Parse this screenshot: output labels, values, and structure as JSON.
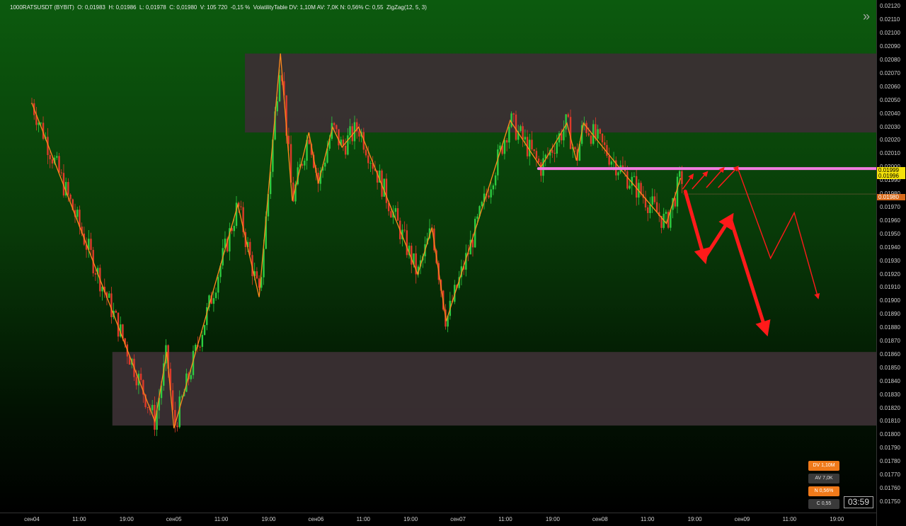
{
  "header": {
    "symbol": "1000RATSUSDT (BYBIT)",
    "open": "O: 0,01983",
    "high": "H: 0,01986",
    "low": "L: 0,01978",
    "close": "C: 0,01980",
    "volume": "V: 105 720",
    "change": "-0,15 %",
    "indicator1": "VolatilityTable  DV: 1,10M  AV: 7,0K  N: 0,56%  C: 0,55",
    "indicator2": "ZigZag(12, 5, 3)"
  },
  "price_tags": {
    "level": "0.01999",
    "level2": "0.01996",
    "last": "0.01980"
  },
  "badges": {
    "dv": "DV 1,10M",
    "av": "AV 7,0K",
    "n": "N 0,56%",
    "c": "C 0,55"
  },
  "clock": "03:59",
  "colors": {
    "zigzag": "#ff8a1c",
    "level_line": "#f07ce0",
    "arrows": "#ff1a1a",
    "zone": "#3a2f33",
    "bull": "#2ecc40",
    "bear": "#e03a2a"
  },
  "chart_data": {
    "type": "candlestick",
    "y_ticks": [
      "0.02120",
      "0.02110",
      "0.02100",
      "0.02090",
      "0.02080",
      "0.02070",
      "0.02060",
      "0.02050",
      "0.02040",
      "0.02030",
      "0.02020",
      "0.02010",
      "0.02000",
      "0.01990",
      "0.01980",
      "0.01970",
      "0.01960",
      "0.01950",
      "0.01940",
      "0.01930",
      "0.01920",
      "0.01910",
      "0.01900",
      "0.01890",
      "0.01880",
      "0.01870",
      "0.01860",
      "0.01850",
      "0.01840",
      "0.01830",
      "0.01820",
      "0.01810",
      "0.01800",
      "0.01790",
      "0.01780",
      "0.01770",
      "0.01760",
      "0.01750"
    ],
    "x_ticks": [
      "сен04",
      "11:00",
      "19:00",
      "сен05",
      "11:00",
      "19:00",
      "сен06",
      "11:00",
      "19:00",
      "сен07",
      "11:00",
      "19:00",
      "сен08",
      "11:00",
      "19:00",
      "сен09",
      "11:00",
      "19:00"
    ],
    "ylim": [
      0.01742,
      0.02125
    ],
    "zones": [
      {
        "name": "supply",
        "top": 0.02085,
        "bottom": 0.02026,
        "from": 4.5,
        "to": 18.1
      },
      {
        "name": "demand",
        "top": 0.01862,
        "bottom": 0.01807,
        "from": 1.7,
        "to": 18.6
      }
    ],
    "level": {
      "price": 0.01999,
      "from": 10.7,
      "to": 18.5
    },
    "zigzag": [
      [
        0.0,
        0.02048
      ],
      [
        2.6,
        0.0181
      ],
      [
        2.85,
        0.01862
      ],
      [
        3.0,
        0.01805
      ],
      [
        4.35,
        0.01972
      ],
      [
        4.8,
        0.01903
      ],
      [
        5.25,
        0.02085
      ],
      [
        5.5,
        0.01975
      ],
      [
        5.85,
        0.02026
      ],
      [
        6.05,
        0.01988
      ],
      [
        6.35,
        0.0203
      ],
      [
        6.55,
        0.02015
      ],
      [
        6.9,
        0.0203
      ],
      [
        8.15,
        0.0192
      ],
      [
        8.45,
        0.01955
      ],
      [
        8.75,
        0.01885
      ],
      [
        10.1,
        0.02035
      ],
      [
        10.75,
        0.02
      ],
      [
        11.3,
        0.02033
      ],
      [
        11.5,
        0.02005
      ],
      [
        11.65,
        0.02033
      ],
      [
        12.4,
        0.02
      ],
      [
        13.4,
        0.01958
      ],
      [
        13.7,
        0.01992
      ]
    ],
    "arrows": [
      {
        "from": [
          13.8,
          0.01982
        ],
        "to": [
          14.2,
          0.01932
        ],
        "width": 5
      },
      {
        "from": [
          14.2,
          0.01932
        ],
        "to": [
          14.75,
          0.01962
        ],
        "width": 5
      },
      {
        "from": [
          14.75,
          0.01962
        ],
        "to": [
          15.5,
          0.01878
        ],
        "width": 5
      },
      {
        "from": [
          13.75,
          0.01984
        ],
        "to": [
          13.95,
          0.01994
        ],
        "width": 1.5
      },
      {
        "from": [
          13.95,
          0.01984
        ],
        "to": [
          14.25,
          0.01996
        ],
        "width": 1.5
      },
      {
        "from": [
          14.25,
          0.01985
        ],
        "to": [
          14.6,
          0.01999
        ],
        "width": 1.5
      },
      {
        "from": [
          14.5,
          0.01985
        ],
        "to": [
          14.9,
          0.02
        ],
        "width": 1.5
      }
    ],
    "projection": [
      [
        14.9,
        0.02
      ],
      [
        15.6,
        0.01932
      ],
      [
        16.1,
        0.01966
      ],
      [
        16.6,
        0.01903
      ]
    ],
    "last_price": 0.0198,
    "candles_note": "~280 intraday candles following the zigzag path"
  }
}
